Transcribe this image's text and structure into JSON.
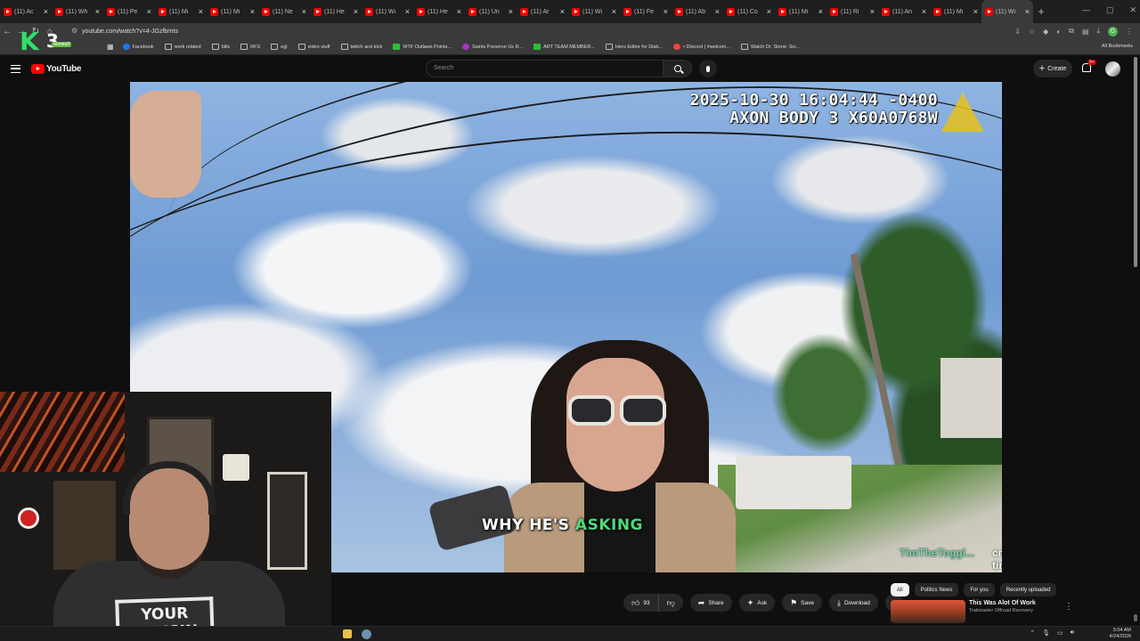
{
  "browser": {
    "tabs": [
      {
        "title": "(11) Ac"
      },
      {
        "title": "(11) Wh"
      },
      {
        "title": "(11) Pe"
      },
      {
        "title": "(11) Mi"
      },
      {
        "title": "(11) Mi"
      },
      {
        "title": "(11) Ne"
      },
      {
        "title": "(11) He"
      },
      {
        "title": "(11) Wi"
      },
      {
        "title": "(11) He"
      },
      {
        "title": "(11) Un"
      },
      {
        "title": "(11) Ar"
      },
      {
        "title": "(11) Wi"
      },
      {
        "title": "(11) Fe"
      },
      {
        "title": "(11) Ab"
      },
      {
        "title": "(11) Co"
      },
      {
        "title": "(11) Mi"
      },
      {
        "title": "(11) Ri"
      },
      {
        "title": "(11) An"
      },
      {
        "title": "(11) Mi"
      },
      {
        "title": "(11) Wi"
      }
    ],
    "new_tab": "+",
    "url": "youtube.com/watch?v=4-JGzfbrnts",
    "bookmarks": [
      {
        "label": "Facebook",
        "icon": "facebook-icon"
      },
      {
        "label": "work related",
        "icon": "folder-icon"
      },
      {
        "label": "bills",
        "icon": "folder-icon"
      },
      {
        "label": "RFS",
        "icon": "folder-icon"
      },
      {
        "label": "egl",
        "icon": "folder-icon"
      },
      {
        "label": "video stuff",
        "icon": "folder-icon"
      },
      {
        "label": "twitch and kick",
        "icon": "folder-icon"
      },
      {
        "label": "WTF Outlaws Points...",
        "icon": "green-icon"
      },
      {
        "label": "Saints Preserve Us R...",
        "icon": "pink-icon"
      },
      {
        "label": "ART TEAM MEMBER...",
        "icon": "green-icon"
      },
      {
        "label": "Hero Editor for Diab...",
        "icon": "folder-icon"
      },
      {
        "label": "• Discord | #welcom...",
        "icon": "discord-icon"
      },
      {
        "label": "Watch Dr. Stone: Sci...",
        "icon": "folder-icon"
      }
    ],
    "all_bookmarks": "All Bookmarks",
    "overlay_tag": "remstuff",
    "overlay_logo_letter": "K",
    "overlay_logo_number": "3"
  },
  "youtube": {
    "logo": "YouTube",
    "search_placeholder": "Search",
    "create_label": "Create",
    "notification_count": "9+"
  },
  "video": {
    "timestamp_line": "2025-10-30 16:04:44 -0400",
    "device_line": "AXON BODY 3 X60A0768W",
    "caption_part1": "WHY HE'S",
    "caption_part2": "ASKING",
    "chat_user": "TimTheToggl...",
    "chat_message": "crime timeee"
  },
  "webcam": {
    "shirt_text": "YOUR COUSIN"
  },
  "actions": {
    "like_count": "93",
    "share": "Share",
    "ask": "Ask",
    "save": "Save",
    "download": "Download"
  },
  "sidebar": {
    "chips": [
      "All",
      "Politics News",
      "For you",
      "Recently uploaded"
    ],
    "recommendation": {
      "title": "This Was Alot Of Work",
      "channel": "Trailmaster Offroad Recovery"
    }
  },
  "taskbar": {
    "time": "5:04 AM",
    "date": "4/24/2026"
  }
}
